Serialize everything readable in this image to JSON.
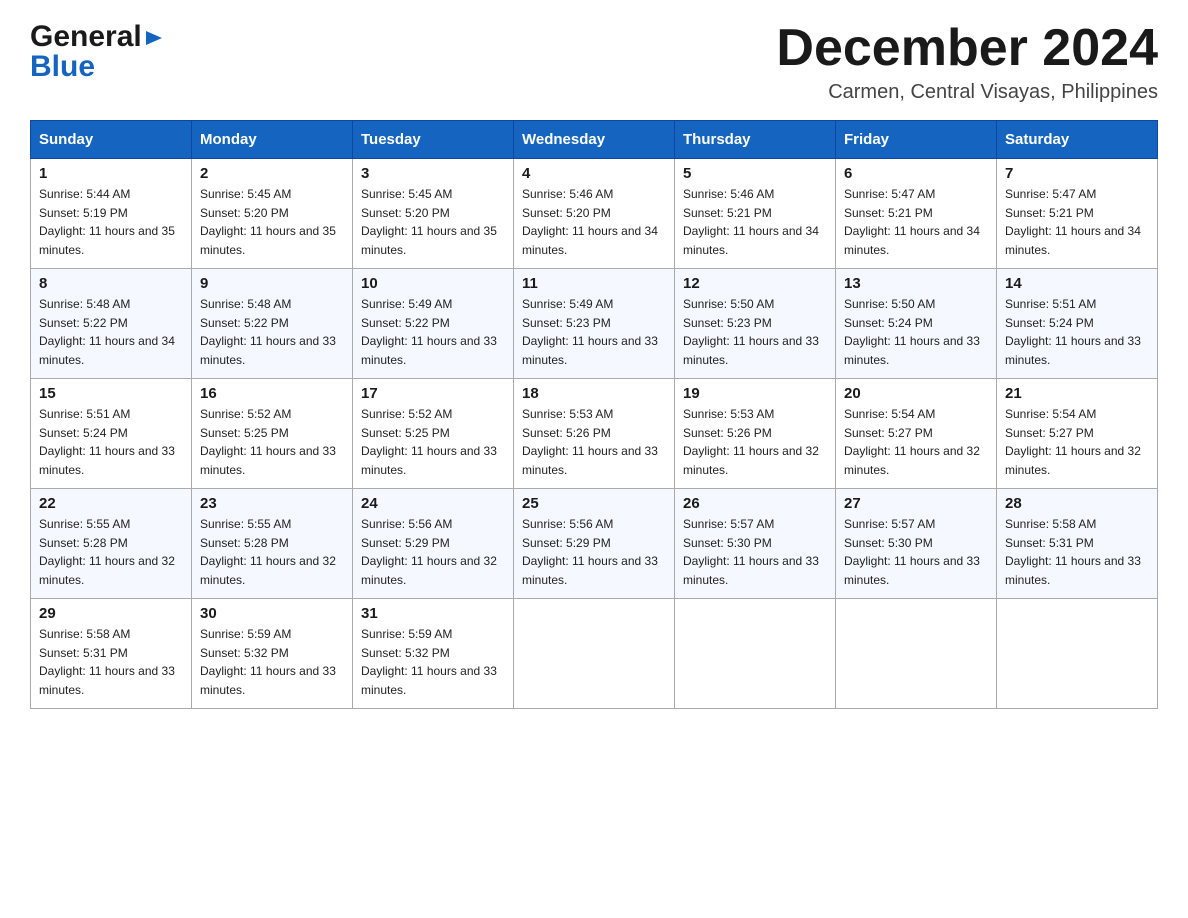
{
  "header": {
    "logo": {
      "general": "General",
      "blue": "Blue",
      "alt": "GeneralBlue logo"
    },
    "title": "December 2024",
    "location": "Carmen, Central Visayas, Philippines"
  },
  "days_of_week": [
    "Sunday",
    "Monday",
    "Tuesday",
    "Wednesday",
    "Thursday",
    "Friday",
    "Saturday"
  ],
  "weeks": [
    [
      {
        "day": "1",
        "sunrise": "5:44 AM",
        "sunset": "5:19 PM",
        "daylight": "11 hours and 35 minutes."
      },
      {
        "day": "2",
        "sunrise": "5:45 AM",
        "sunset": "5:20 PM",
        "daylight": "11 hours and 35 minutes."
      },
      {
        "day": "3",
        "sunrise": "5:45 AM",
        "sunset": "5:20 PM",
        "daylight": "11 hours and 35 minutes."
      },
      {
        "day": "4",
        "sunrise": "5:46 AM",
        "sunset": "5:20 PM",
        "daylight": "11 hours and 34 minutes."
      },
      {
        "day": "5",
        "sunrise": "5:46 AM",
        "sunset": "5:21 PM",
        "daylight": "11 hours and 34 minutes."
      },
      {
        "day": "6",
        "sunrise": "5:47 AM",
        "sunset": "5:21 PM",
        "daylight": "11 hours and 34 minutes."
      },
      {
        "day": "7",
        "sunrise": "5:47 AM",
        "sunset": "5:21 PM",
        "daylight": "11 hours and 34 minutes."
      }
    ],
    [
      {
        "day": "8",
        "sunrise": "5:48 AM",
        "sunset": "5:22 PM",
        "daylight": "11 hours and 34 minutes."
      },
      {
        "day": "9",
        "sunrise": "5:48 AM",
        "sunset": "5:22 PM",
        "daylight": "11 hours and 33 minutes."
      },
      {
        "day": "10",
        "sunrise": "5:49 AM",
        "sunset": "5:22 PM",
        "daylight": "11 hours and 33 minutes."
      },
      {
        "day": "11",
        "sunrise": "5:49 AM",
        "sunset": "5:23 PM",
        "daylight": "11 hours and 33 minutes."
      },
      {
        "day": "12",
        "sunrise": "5:50 AM",
        "sunset": "5:23 PM",
        "daylight": "11 hours and 33 minutes."
      },
      {
        "day": "13",
        "sunrise": "5:50 AM",
        "sunset": "5:24 PM",
        "daylight": "11 hours and 33 minutes."
      },
      {
        "day": "14",
        "sunrise": "5:51 AM",
        "sunset": "5:24 PM",
        "daylight": "11 hours and 33 minutes."
      }
    ],
    [
      {
        "day": "15",
        "sunrise": "5:51 AM",
        "sunset": "5:24 PM",
        "daylight": "11 hours and 33 minutes."
      },
      {
        "day": "16",
        "sunrise": "5:52 AM",
        "sunset": "5:25 PM",
        "daylight": "11 hours and 33 minutes."
      },
      {
        "day": "17",
        "sunrise": "5:52 AM",
        "sunset": "5:25 PM",
        "daylight": "11 hours and 33 minutes."
      },
      {
        "day": "18",
        "sunrise": "5:53 AM",
        "sunset": "5:26 PM",
        "daylight": "11 hours and 33 minutes."
      },
      {
        "day": "19",
        "sunrise": "5:53 AM",
        "sunset": "5:26 PM",
        "daylight": "11 hours and 32 minutes."
      },
      {
        "day": "20",
        "sunrise": "5:54 AM",
        "sunset": "5:27 PM",
        "daylight": "11 hours and 32 minutes."
      },
      {
        "day": "21",
        "sunrise": "5:54 AM",
        "sunset": "5:27 PM",
        "daylight": "11 hours and 32 minutes."
      }
    ],
    [
      {
        "day": "22",
        "sunrise": "5:55 AM",
        "sunset": "5:28 PM",
        "daylight": "11 hours and 32 minutes."
      },
      {
        "day": "23",
        "sunrise": "5:55 AM",
        "sunset": "5:28 PM",
        "daylight": "11 hours and 32 minutes."
      },
      {
        "day": "24",
        "sunrise": "5:56 AM",
        "sunset": "5:29 PM",
        "daylight": "11 hours and 32 minutes."
      },
      {
        "day": "25",
        "sunrise": "5:56 AM",
        "sunset": "5:29 PM",
        "daylight": "11 hours and 33 minutes."
      },
      {
        "day": "26",
        "sunrise": "5:57 AM",
        "sunset": "5:30 PM",
        "daylight": "11 hours and 33 minutes."
      },
      {
        "day": "27",
        "sunrise": "5:57 AM",
        "sunset": "5:30 PM",
        "daylight": "11 hours and 33 minutes."
      },
      {
        "day": "28",
        "sunrise": "5:58 AM",
        "sunset": "5:31 PM",
        "daylight": "11 hours and 33 minutes."
      }
    ],
    [
      {
        "day": "29",
        "sunrise": "5:58 AM",
        "sunset": "5:31 PM",
        "daylight": "11 hours and 33 minutes."
      },
      {
        "day": "30",
        "sunrise": "5:59 AM",
        "sunset": "5:32 PM",
        "daylight": "11 hours and 33 minutes."
      },
      {
        "day": "31",
        "sunrise": "5:59 AM",
        "sunset": "5:32 PM",
        "daylight": "11 hours and 33 minutes."
      },
      null,
      null,
      null,
      null
    ]
  ],
  "labels": {
    "sunrise": "Sunrise:",
    "sunset": "Sunset:",
    "daylight": "Daylight:"
  }
}
